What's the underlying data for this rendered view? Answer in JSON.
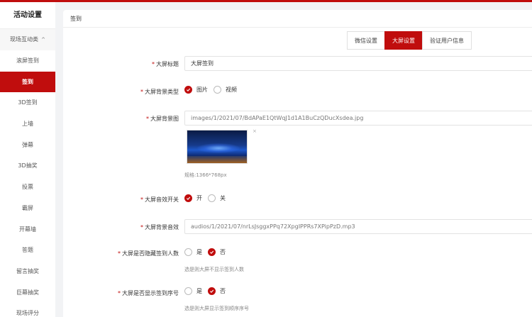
{
  "sidebar": {
    "title": "活动设置",
    "group": "现场互动类",
    "items": [
      {
        "label": "滚屏签到",
        "active": false
      },
      {
        "label": "签到",
        "active": true
      },
      {
        "label": "3D签到",
        "active": false
      },
      {
        "label": "上墙",
        "active": false
      },
      {
        "label": "弹幕",
        "active": false
      },
      {
        "label": "3D抽奖",
        "active": false
      },
      {
        "label": "投票",
        "active": false
      },
      {
        "label": "霸屏",
        "active": false
      },
      {
        "label": "开幕墙",
        "active": false
      },
      {
        "label": "答题",
        "active": false
      },
      {
        "label": "留言抽奖",
        "active": false
      },
      {
        "label": "巨幕抽奖",
        "active": false
      },
      {
        "label": "现场评分",
        "active": false
      }
    ]
  },
  "panel": {
    "header": "签到",
    "tabs": [
      {
        "label": "微信设置",
        "active": false
      },
      {
        "label": "大屏设置",
        "active": true
      },
      {
        "label": "验证用户信息",
        "active": false
      }
    ]
  },
  "form": {
    "title": {
      "label": "大屏标题",
      "value": "大屏签到"
    },
    "bg_type": {
      "label": "大屏背景类型",
      "options": [
        "图片",
        "视频"
      ],
      "selected": "图片"
    },
    "bg_image": {
      "label": "大屏背景图",
      "value": "images/1/2021/07/BdAPaE1QtWqJ1d1A1BuCzQDucXsdea.jpg",
      "size_hint": "规格:1366*768px",
      "remove": "×"
    },
    "sound_switch": {
      "label": "大屏音效开关",
      "options": [
        "开",
        "关"
      ],
      "selected": "开"
    },
    "sound_file": {
      "label": "大屏背景音效",
      "value": "audios/1/2021/07/nrLsJsggxPPq72XpgIPPRs7XPipPzD.mp3"
    },
    "hide_count": {
      "label": "大屏是否隐藏签到人数",
      "options": [
        "是",
        "否"
      ],
      "selected": "否",
      "hint": "选是则大屏不显示签到人数"
    },
    "show_order": {
      "label": "大屏是否显示签到序号",
      "options": [
        "是",
        "否"
      ],
      "selected": "否",
      "hint": "选是则大屏显示签到顺序序号"
    }
  },
  "colors": {
    "accent": "#c00d0d",
    "bg": "#f2f3f5"
  }
}
